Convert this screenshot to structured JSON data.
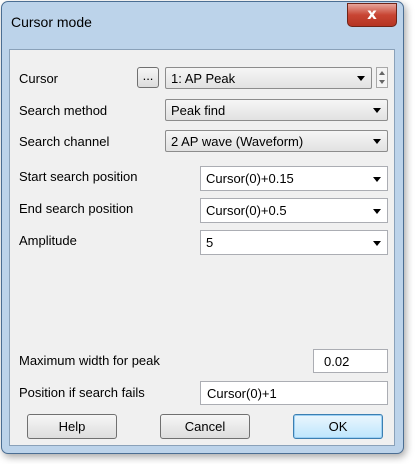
{
  "window": {
    "title": "Cursor mode",
    "close_label": "x"
  },
  "cursor": {
    "label": "Cursor",
    "ellipsis_label": "...",
    "value": "1: AP Peak"
  },
  "search_method": {
    "label": "Search method",
    "value": "Peak find"
  },
  "search_channel": {
    "label": "Search channel",
    "value": "2 AP wave (Waveform)"
  },
  "start_search": {
    "label": "Start search position",
    "value": "Cursor(0)+0.15"
  },
  "end_search": {
    "label": "End search position",
    "value": "Cursor(0)+0.5"
  },
  "amplitude": {
    "label": "Amplitude",
    "value": "5"
  },
  "max_width": {
    "label": "Maximum width for peak",
    "value": "0.02"
  },
  "position_fail": {
    "label": "Position if search fails",
    "value": "Cursor(0)+1"
  },
  "buttons": {
    "help": "Help",
    "cancel": "Cancel",
    "ok": "OK"
  }
}
